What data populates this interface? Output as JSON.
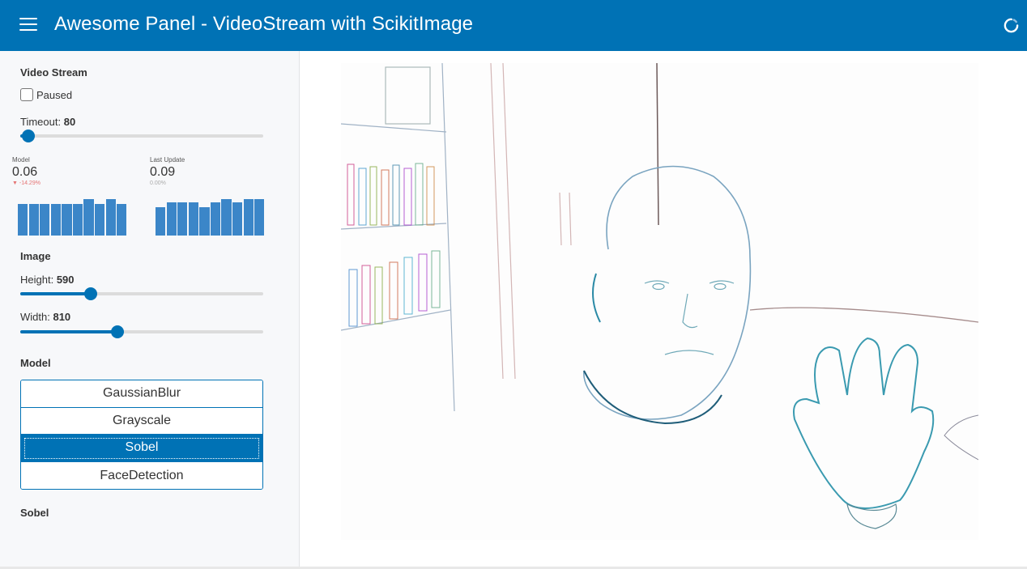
{
  "header": {
    "title": "Awesome Panel - VideoStream with ScikitImage",
    "menu_icon": "hamburger-menu-icon",
    "busy_icon": "busy-indicator-icon",
    "background_color": "#0072b5"
  },
  "sidebar": {
    "video_stream": {
      "title": "Video Stream",
      "paused_label": "Paused",
      "paused": false,
      "timeout_label": "Timeout:",
      "timeout_value": "80"
    },
    "stats": {
      "model": {
        "label": "Model",
        "value": "0.06",
        "delta": "▼ -14.29%",
        "bars": [
          0.81,
          0.81,
          0.81,
          0.81,
          0.81,
          0.81,
          0.94,
          0.81,
          0.94,
          0.81
        ]
      },
      "last_update": {
        "label": "Last Update",
        "value": "0.09",
        "delta": "0.00%",
        "bars": [
          0.73,
          0.85,
          0.85,
          0.85,
          0.73,
          0.85,
          0.94,
          0.85,
          0.94,
          0.94
        ]
      }
    },
    "image": {
      "title": "Image",
      "height_label": "Height:",
      "height_value": "590",
      "width_label": "Width:",
      "width_value": "810"
    },
    "model": {
      "title": "Model",
      "options": [
        "GaussianBlur",
        "Grayscale",
        "Sobel",
        "FaceDetection"
      ],
      "selected": "Sobel"
    },
    "selected_model_title": "Sobel"
  },
  "colors": {
    "accent": "#0072b5",
    "spark_bar": "#3b86c8",
    "delta_down": "#e57373"
  }
}
